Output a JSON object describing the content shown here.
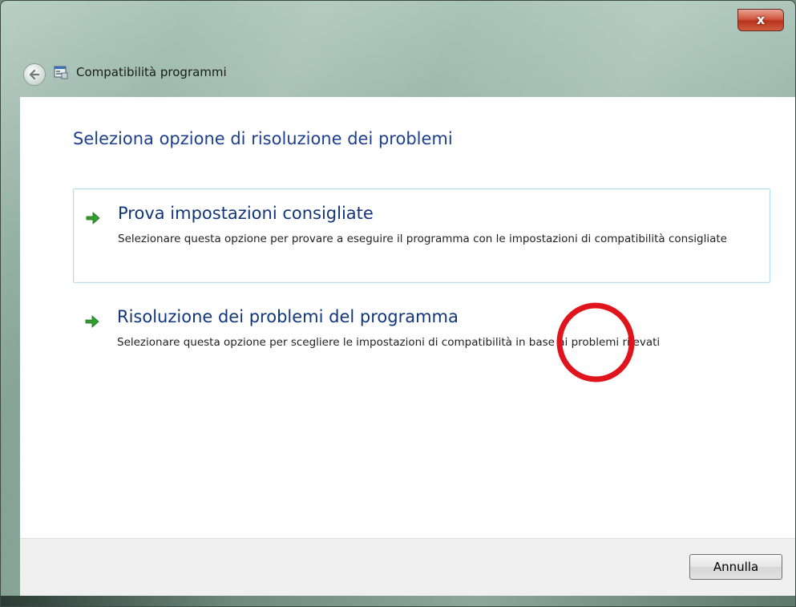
{
  "window": {
    "title": "Compatibilità programmi",
    "close_symbol": "x",
    "accent_color": "#1e3f8f",
    "close_color": "#c8442c"
  },
  "content": {
    "heading": "Seleziona opzione di risoluzione dei problemi",
    "options": [
      {
        "title": "Prova impostazioni consigliate",
        "description": "Selezionare questa opzione per provare a eseguire il programma con le impostazioni di compatibilità consigliate",
        "icon": "green-arrow-icon",
        "selected": true
      },
      {
        "title": "Risoluzione dei problemi del programma",
        "description": "Selezionare questa opzione per scegliere le impostazioni di compatibilità in base ai problemi rilevati",
        "icon": "green-arrow-icon",
        "selected": false
      }
    ]
  },
  "footer": {
    "cancel_label": "Annulla"
  },
  "annotation": {
    "shape": "red-circle",
    "color": "#e0141c"
  },
  "icons": {
    "back": "back-arrow-icon",
    "app": "program-compatibility-icon",
    "close": "close-icon"
  }
}
